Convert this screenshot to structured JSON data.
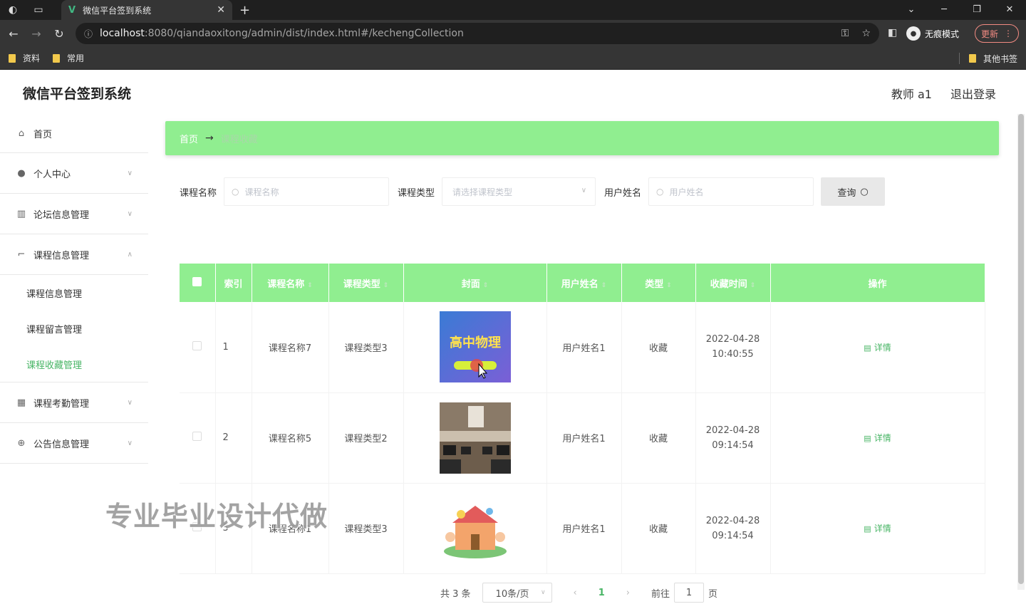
{
  "browser": {
    "tab_title": "微信平台签到系统",
    "url_host": "localhost",
    "url_rest": ":8080/qiandaoxitong/admin/dist/index.html#/kechengCollection",
    "profile_label": "无痕模式",
    "update_label": "更新",
    "bookmarks": [
      "资料",
      "常用"
    ],
    "other_bookmarks": "其他书签"
  },
  "header": {
    "title": "微信平台签到系统",
    "user": "教师 a1",
    "logout": "退出登录"
  },
  "sidebar": {
    "home": "首页",
    "personal": "个人中心",
    "forum": "论坛信息管理",
    "course": "课程信息管理",
    "course_subs": [
      "课程信息管理",
      "课程留言管理",
      "课程收藏管理"
    ],
    "attendance": "课程考勤管理",
    "notice": "公告信息管理"
  },
  "breadcrumb": {
    "home": "首页",
    "arrow": "→",
    "current": "课程收藏"
  },
  "search": {
    "course_name_label": "课程名称",
    "course_name_placeholder": "课程名称",
    "course_type_label": "课程类型",
    "course_type_placeholder": "请选择课程类型",
    "user_name_label": "用户姓名",
    "user_name_placeholder": "用户姓名",
    "query_button": "查询"
  },
  "table": {
    "headers": [
      "索引",
      "课程名称",
      "课程类型",
      "封面",
      "用户姓名",
      "类型",
      "收藏时间",
      "操作"
    ],
    "rows": [
      {
        "index": "1",
        "course_name": "课程名称7",
        "course_type": "课程类型3",
        "user_name": "用户姓名1",
        "kind": "收藏",
        "date": "2022-04-28",
        "time": "10:40:55",
        "action": "详情",
        "cover_text": "高中物理"
      },
      {
        "index": "2",
        "course_name": "课程名称5",
        "course_type": "课程类型2",
        "user_name": "用户姓名1",
        "kind": "收藏",
        "date": "2022-04-28",
        "time": "09:14:54",
        "action": "详情"
      },
      {
        "index": "3",
        "course_name": "课程名称1",
        "course_type": "课程类型3",
        "user_name": "用户姓名1",
        "kind": "收藏",
        "date": "2022-04-28",
        "time": "09:14:54",
        "action": "详情"
      }
    ]
  },
  "watermark": "专业毕业设计代做",
  "pagination": {
    "total": "共 3 条",
    "page_size": "10条/页",
    "current_page": "1",
    "goto_label": "前往",
    "goto_value": "1",
    "page_suffix": "页"
  },
  "colors": {
    "accent_green": "#90ee90",
    "active_text": "#48b565"
  }
}
